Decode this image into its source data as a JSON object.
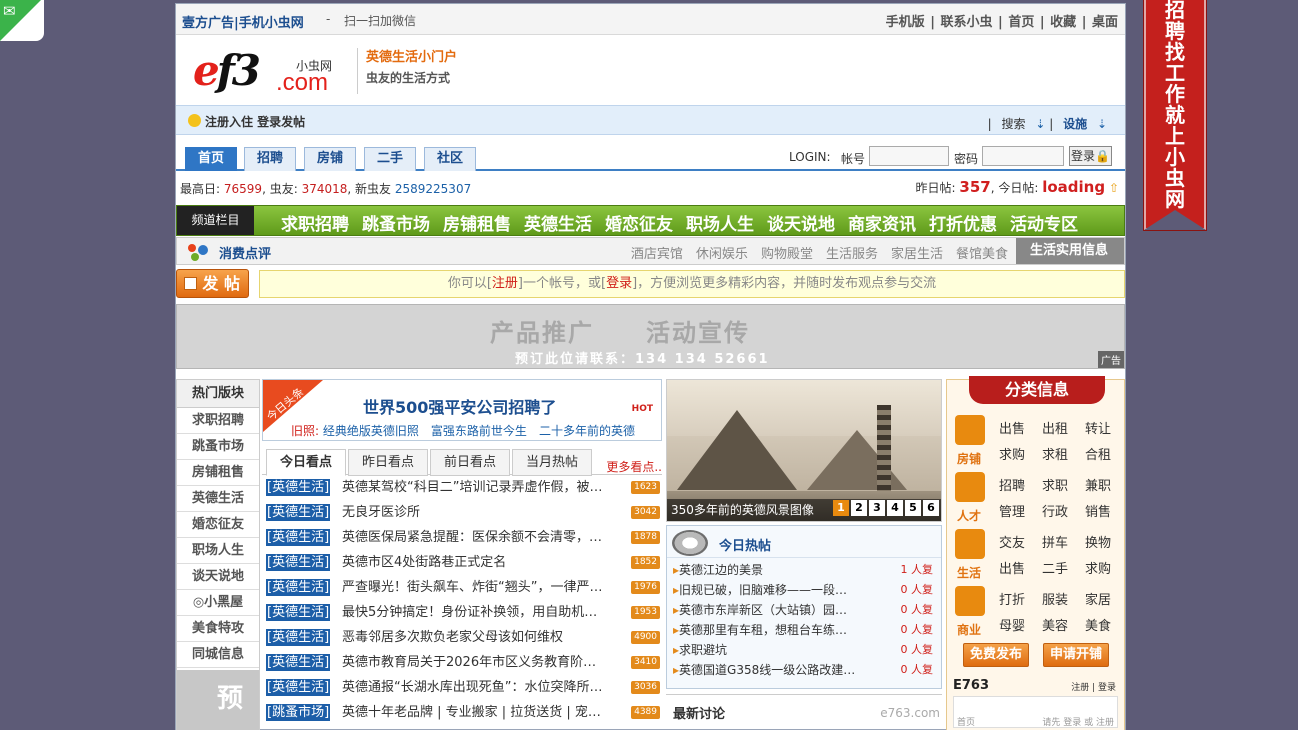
{
  "topbar": {
    "brand": "壹方广告|手机小虫网",
    "dash": "-",
    "scan": "扫一扫加微信",
    "links": [
      "手机版",
      "联系小虫",
      "首页",
      "收藏",
      "桌面"
    ]
  },
  "ribbon": {
    "text": "招聘找工作就上小虫网"
  },
  "logo": {
    "e_text": "e",
    "f3_text": "f3",
    "com_text": ".com",
    "cn_name": "小虫网"
  },
  "slogan": {
    "line1": "英德生活小门户",
    "line2": "虫友的生活方式"
  },
  "userbar": {
    "register": "注册入住 登录发帖",
    "search": "搜索",
    "settings": "设施"
  },
  "tabs": [
    "首页",
    "招聘",
    "房铺",
    "二手",
    "社区"
  ],
  "login": {
    "label": "LOGIN:",
    "account_label": "帐号",
    "password_label": "密码",
    "button": "登录"
  },
  "stats": {
    "max_day_label": "最高日:",
    "max_day": "76599",
    "members_label": ", 虫友:",
    "members": "374018",
    "new_label": ", 新虫友",
    "new_member": "2589225307",
    "yesterday_label": "昨日帖:",
    "yesterday": "357",
    "today_label": ", 今日帖:",
    "today": "loading"
  },
  "catbar": {
    "tag": "频道栏目",
    "items": [
      "求职招聘",
      "跳蚤市场",
      "房铺租售",
      "英德生活",
      "婚恋征友",
      "职场人生",
      "谈天说地",
      "商家资讯",
      "打折优惠",
      "活动专区"
    ]
  },
  "subbar": {
    "title": "消费点评",
    "items": [
      "酒店宾馆",
      "休闲娱乐",
      "购物殿堂",
      "生活服务",
      "家居生活",
      "餐馆美食"
    ],
    "life": "生活实用信息"
  },
  "post": {
    "button": "发 帖",
    "notice_pre": "你可以[",
    "notice_reg": "注册",
    "notice_mid": "]一个帐号，或[",
    "notice_login": "登录",
    "notice_post": "]，方便浏览更多精彩内容，并随时发布观点参与交流"
  },
  "ad": {
    "line1": "产品推广　　活动宣传",
    "line2": "预订此位请联系：134 134 52661",
    "tag": "广告"
  },
  "leftnav": {
    "title": "热门版块",
    "items": [
      "求职招聘",
      "跳蚤市场",
      "房铺租售",
      "英德生活",
      "婚恋征友",
      "职场人生",
      "谈天说地",
      "◎小黑屋",
      "美食特攻",
      "同城信息"
    ],
    "ad_text": "预"
  },
  "headline": {
    "corner": "今日头条",
    "title": "世界500强平安公司招聘了",
    "hot": "HOT",
    "old_label": "旧照:",
    "links": [
      "经典绝版英德旧照",
      "富强东路前世今生",
      "二十多年前的英德"
    ]
  },
  "news": {
    "tabs": [
      "今日看点",
      "昨日看点",
      "前日看点",
      "当月热帖"
    ],
    "more": "更多看点..",
    "items": [
      {
        "cat": "[英德生活]",
        "title": "英德某驾校“科目二”培训记录弄虚作假，被…",
        "count": "1623"
      },
      {
        "cat": "[英德生活]",
        "title": "无良牙医诊所",
        "count": "3042"
      },
      {
        "cat": "[英德生活]",
        "title": "英德医保局紧急提醒：医保余额不会清零，…",
        "count": "1878"
      },
      {
        "cat": "[英德生活]",
        "title": "英德市区4处街路巷正式定名",
        "count": "1852"
      },
      {
        "cat": "[英德生活]",
        "title": "严查曝光！街头飙车、炸街“翘头”，一律严…",
        "count": "1976"
      },
      {
        "cat": "[英德生活]",
        "title": "最快5分钟搞定！身份证补换领，用自助机…",
        "count": "1953"
      },
      {
        "cat": "[英德生活]",
        "title": "恶毒邻居多次欺负老家父母该如何维权",
        "count": "4900"
      },
      {
        "cat": "[英德生活]",
        "title": "英德市教育局关于2026年市区义务教育阶…",
        "count": "3410"
      },
      {
        "cat": "[英德生活]",
        "title": "英德通报“长湖水库出现死鱼”：水位突降所…",
        "count": "3036"
      },
      {
        "cat": "[跳蚤市场]",
        "title": "英德十年老品牌 | 专业搬家 | 拉货送货 | 宠…",
        "count": "4389"
      }
    ]
  },
  "photo": {
    "caption": "350多年前的英德风景图像",
    "pages": [
      "1",
      "2",
      "3",
      "4",
      "5",
      "6"
    ]
  },
  "hotposts": {
    "title": "今日热帖",
    "items": [
      {
        "title": "英德江边的美景",
        "replies": "1 人复"
      },
      {
        "title": "旧规已破，旧脑难移——一段视…",
        "replies": "0 人复"
      },
      {
        "title": "英德市东岸新区（大站镇）园山…",
        "replies": "0 人复"
      },
      {
        "title": "英德那里有车租，想租台车练练手",
        "replies": "0 人复"
      },
      {
        "title": "求职避坑",
        "replies": "0 人复"
      },
      {
        "title": "英德国道G358线一级公路改建…",
        "replies": "0 人复"
      }
    ]
  },
  "latest": {
    "title": "最新讨论",
    "watermark": "e763.com"
  },
  "classified": {
    "title": "分类信息",
    "groups": [
      {
        "label": "房铺",
        "row1": [
          "出售",
          "出租",
          "转让"
        ],
        "row2": [
          "求购",
          "求租",
          "合租"
        ]
      },
      {
        "label": "人才",
        "row1": [
          "招聘",
          "求职",
          "兼职"
        ],
        "row2": [
          "管理",
          "行政",
          "销售"
        ]
      },
      {
        "label": "生活",
        "row1": [
          "交友",
          "拼车",
          "换物"
        ],
        "row2": [
          "出售",
          "二手",
          "求购"
        ]
      },
      {
        "label": "商业",
        "row1": [
          "打折",
          "服装",
          "家居"
        ],
        "row2": [
          "母婴",
          "美容",
          "美食"
        ]
      }
    ],
    "free_post": "免费发布",
    "apply_shop": "申请开铺",
    "e763": "E763",
    "reg_login": "注册 | 登录",
    "mini_home": "首页",
    "mini_links": "请先 登录 或 注册"
  },
  "colors": {
    "accent_blue": "#1c4e8f",
    "accent_red": "#c4201d",
    "green_bar": "#6fab28",
    "orange": "#e38a1b",
    "background": "#5d5b77"
  }
}
